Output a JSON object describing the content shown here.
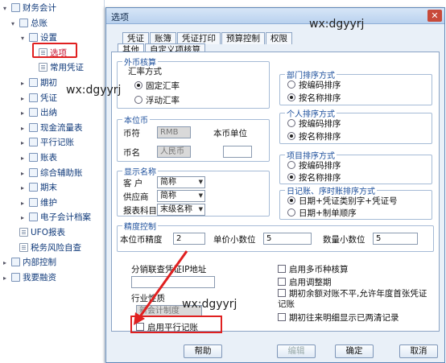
{
  "tree": {
    "items": [
      {
        "label": "财务会计",
        "level": 0,
        "arrow": "▾",
        "icon": "folder"
      },
      {
        "label": "总账",
        "level": 1,
        "arrow": "▾",
        "icon": "folder"
      },
      {
        "label": "设置",
        "level": 2,
        "arrow": "▾",
        "icon": "folder"
      },
      {
        "label": "选项",
        "level": 3,
        "arrow": "",
        "icon": "doc",
        "selected": true
      },
      {
        "label": "常用凭证",
        "level": 3,
        "arrow": "",
        "icon": "doc"
      },
      {
        "label": "期初",
        "level": 2,
        "arrow": "▸",
        "icon": "folder"
      },
      {
        "label": "凭证",
        "level": 2,
        "arrow": "▸",
        "icon": "folder"
      },
      {
        "label": "出纳",
        "level": 2,
        "arrow": "▸",
        "icon": "folder"
      },
      {
        "label": "现金流量表",
        "level": 2,
        "arrow": "▸",
        "icon": "folder"
      },
      {
        "label": "平行记账",
        "level": 2,
        "arrow": "▸",
        "icon": "folder"
      },
      {
        "label": "账表",
        "level": 2,
        "arrow": "▸",
        "icon": "folder"
      },
      {
        "label": "综合辅助账",
        "level": 2,
        "arrow": "▸",
        "icon": "folder"
      },
      {
        "label": "期末",
        "level": 2,
        "arrow": "▸",
        "icon": "folder"
      },
      {
        "label": "维护",
        "level": 2,
        "arrow": "▸",
        "icon": "folder"
      },
      {
        "label": "电子会计档案",
        "level": 2,
        "arrow": "▸",
        "icon": "folder"
      },
      {
        "label": "UFO报表",
        "level": 1,
        "arrow": "",
        "icon": "doc"
      },
      {
        "label": "税务风险自查",
        "level": 1,
        "arrow": "",
        "icon": "doc"
      },
      {
        "label": "内部控制",
        "level": 0,
        "arrow": "▸",
        "icon": "folder"
      },
      {
        "label": "我要融资",
        "level": 0,
        "arrow": "▸",
        "icon": "folder"
      }
    ]
  },
  "dialog": {
    "title": "选项",
    "close_glyph": "✕",
    "tabs_row1": [
      "凭证",
      "账簿",
      "凭证打印",
      "预算控制",
      "权限"
    ],
    "tabs_row2": [
      "其他",
      "自定义项核算"
    ],
    "active_tab": "其他",
    "exchange": {
      "legend": "外币核算",
      "label": "汇率方式",
      "options": [
        "固定汇率",
        "浮动汇率"
      ],
      "selected": 0
    },
    "base_currency": {
      "legend": "本位币",
      "code_label": "币符",
      "code_value": "RMB",
      "name_label": "币名",
      "name_value": "人民币",
      "unit_label": "本币单位",
      "unit_value": ""
    },
    "display_name": {
      "legend": "显示名称",
      "rows": [
        {
          "label": "客 户",
          "value": "简称"
        },
        {
          "label": "供应商",
          "value": "简称"
        },
        {
          "label": "报表科目",
          "value": "末级名称"
        }
      ]
    },
    "dept_sort": {
      "legend": "部门排序方式",
      "options": [
        "按编码排序",
        "按名称排序"
      ],
      "selected": 1
    },
    "person_sort": {
      "legend": "个人排序方式",
      "options": [
        "按编码排序",
        "按名称排序"
      ],
      "selected": 1
    },
    "project_sort": {
      "legend": "项目排序方式",
      "options": [
        "按编码排序",
        "按名称排序"
      ],
      "selected": 1
    },
    "journal_sort": {
      "legend": "日记账、序时账排序方式",
      "options": [
        "日期+凭证类别字+凭证号",
        "日期+制单顺序"
      ],
      "selected": 0
    },
    "precision": {
      "legend": "精度控制",
      "base_label": "本位币精度",
      "base_value": "2",
      "unit_label": "单价小数位",
      "unit_value": "5",
      "qty_label": "数量小数位",
      "qty_value": "5"
    },
    "voucher_ip_label": "分销联查凭证IP地址",
    "industry_label": "行业性质",
    "industry_value": "新会计制度",
    "parallel_label": "启用平行记账",
    "right_checks": [
      "启用多币种核算",
      "启用调整期",
      "期初余额对账不平,允许年度首张凭证记账",
      "期初往来明细显示已两清记录"
    ],
    "buttons": {
      "help": "帮助",
      "edit": "编辑",
      "ok": "确定",
      "cancel": "取消"
    }
  },
  "watermark": "wx:dgyyrj",
  "colors": {
    "highlight": "#e02020",
    "accent": "#1c4f9c"
  }
}
